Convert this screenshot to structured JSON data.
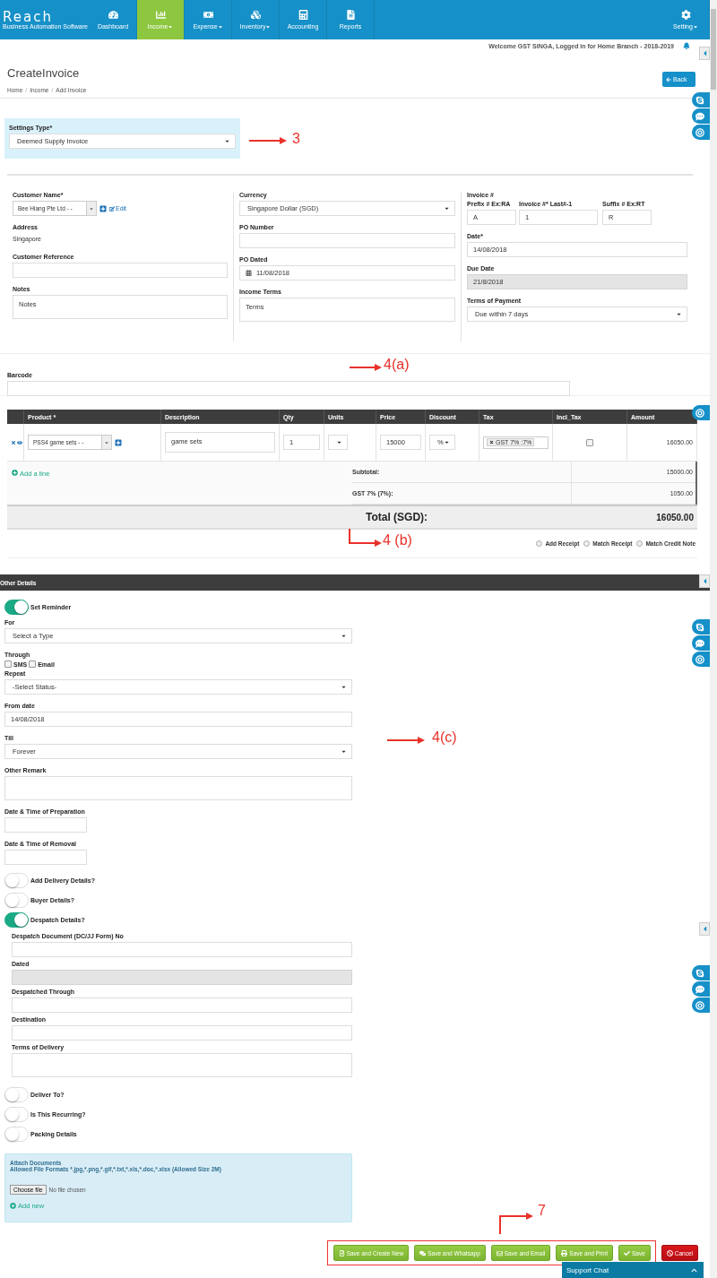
{
  "nav": {
    "logo": "Reach",
    "logo_sub": "Business Automation Software",
    "items": [
      {
        "label": "Dashboard",
        "selected": false,
        "dropdown": false
      },
      {
        "label": "Income",
        "selected": true,
        "dropdown": true
      },
      {
        "label": "Expense",
        "selected": false,
        "dropdown": true
      },
      {
        "label": "Inventory",
        "selected": false,
        "dropdown": true
      },
      {
        "label": "Accounting",
        "selected": false,
        "dropdown": false
      },
      {
        "label": "Reports",
        "selected": false,
        "dropdown": false
      }
    ],
    "setting": {
      "label": "Setting",
      "dropdown": true
    }
  },
  "welcome": "Welcome GST SINGA, Logged in for Home Branch - 2018-2019",
  "page_title": "CreateInvoice",
  "breadcrumb": [
    {
      "label": "Home",
      "separator": "/"
    },
    {
      "label": "Income",
      "separator": "/"
    },
    {
      "label": "Add Invoice"
    }
  ],
  "back_button": "Back",
  "settings_type": {
    "label": "Settings Type*",
    "value": "Deemed Supply Invoice"
  },
  "invoice_form": {
    "columns": [
      [
        {
          "kind": "combo",
          "label": "Customer Name*",
          "value": "Bee Hiang Pte Ltd - -",
          "link": "Edit"
        },
        {
          "kind": "text",
          "label": "Address",
          "value": "Singapore"
        },
        {
          "kind": "input",
          "label": "Customer Reference",
          "disabled": false
        },
        {
          "kind": "textarea",
          "label": "Notes",
          "placeholder": "Notes"
        }
      ],
      [
        {
          "kind": "select",
          "label": "Currency",
          "value": "Singapore Dollar (SGD)"
        },
        {
          "kind": "input",
          "label": "PO Number",
          "disabled": false
        },
        {
          "kind": "date",
          "label": "PO Dated",
          "value": "11/08/2018"
        },
        {
          "kind": "textarea",
          "label": "Income Terms",
          "placeholder": "Terms"
        }
      ],
      [
        {
          "kind": "triple",
          "label": "Invoice #",
          "parts": [
            {
              "label": "Prefix # Ex:RA",
              "value": "A"
            },
            {
              "label": "Invoice #* Last#-1",
              "value": "1"
            },
            {
              "label": "Suffix # Ex:RT",
              "value": "R"
            }
          ]
        },
        {
          "kind": "input",
          "label": "Date*",
          "value": "14/08/2018",
          "disabled": false
        },
        {
          "kind": "input",
          "label": "Due Date",
          "value": "21/8/2018",
          "disabled": true
        },
        {
          "kind": "select",
          "label": "Terms of Payment",
          "value": "Due within 7 days"
        }
      ]
    ]
  },
  "barcode": {
    "label": "Barcode"
  },
  "table": {
    "columns": [
      "Product *",
      "Description",
      "Qty",
      "Units",
      "Price",
      "Discount",
      "Tax",
      "Incl_Tax",
      "Amount"
    ],
    "rows": [
      {
        "product": "PSS4 game sets - -",
        "description": "game sets",
        "qty": "1",
        "price": "15000",
        "discount": "%",
        "tax": "GST 7% :7%",
        "incl_tax": false,
        "amount": "16050.00"
      }
    ],
    "add_line": "Add a line",
    "totals": [
      {
        "label": "Subtotal:",
        "value": "15000.00"
      },
      {
        "label": "GST 7% (7%):",
        "value": "1050.00"
      }
    ],
    "total": {
      "label": "Total (SGD):",
      "value": "16050.00"
    },
    "options": [
      {
        "label": "Add Receipt",
        "selected": false
      },
      {
        "label": "Match Receipt",
        "selected": false
      },
      {
        "label": "Match Credit Note",
        "selected": false
      }
    ]
  },
  "other_details": {
    "title": "Other Details",
    "items": [
      {
        "kind": "toggle",
        "label": "Set Reminder",
        "on": true
      },
      {
        "kind": "select",
        "label": "For",
        "value": "Select a Type"
      },
      {
        "kind": "checks",
        "label": "Through",
        "options": [
          {
            "label": "SMS",
            "checked": false
          },
          {
            "label": "Email",
            "checked": false
          }
        ]
      },
      {
        "kind": "select",
        "label": "Repeat",
        "value": "-Select Status-"
      },
      {
        "kind": "input",
        "label": "From date",
        "value": "14/08/2018"
      },
      {
        "kind": "select",
        "label": "Till",
        "value": "Forever"
      },
      {
        "kind": "textarea",
        "label": "Other Remark"
      },
      {
        "kind": "short_input",
        "label": "Date & Time of Preparation"
      },
      {
        "kind": "short_input",
        "label": "Date & Time of Removal"
      },
      {
        "kind": "toggle",
        "label": "Add Delivery Details?",
        "on": false
      },
      {
        "kind": "toggle",
        "label": "Buyer Details?",
        "on": false
      },
      {
        "kind": "toggle",
        "label": "Despatch Details?",
        "on": true,
        "children": [
          {
            "kind": "input",
            "label": "Despatch Document (DC/JJ Form) No",
            "disabled": false
          },
          {
            "kind": "input",
            "label": "Dated",
            "disabled": true
          },
          {
            "kind": "input",
            "label": "Despatched Through",
            "disabled": false
          },
          {
            "kind": "input",
            "label": "Destination",
            "disabled": false
          },
          {
            "kind": "textarea",
            "label": "Terms of Delivery",
            "disabled": false
          }
        ]
      },
      {
        "kind": "toggle",
        "label": "Deliver To?",
        "on": false
      },
      {
        "kind": "toggle",
        "label": "Is This Recurring?",
        "on": false
      },
      {
        "kind": "toggle",
        "label": "Packing Details",
        "on": false
      }
    ],
    "attach": {
      "title": "Attach Documents",
      "formats": "Allowed File Formats *.jpg,*.png,*.gif,*.txt,*.xls,*.doc,*.xlsx (Allowed Size 2M)",
      "choose": "Choose file",
      "status": "No file chosen",
      "add": "Add new"
    }
  },
  "buttons": [
    {
      "label": "Save and Create New",
      "kind": "success",
      "framed": true
    },
    {
      "label": "Save and Whatsapp",
      "kind": "success",
      "framed": true
    },
    {
      "label": "Save and Email",
      "kind": "success",
      "framed": true
    },
    {
      "label": "Save and Print",
      "kind": "success",
      "framed": true
    },
    {
      "label": "Save",
      "kind": "success",
      "framed": true
    },
    {
      "label": "Cancel",
      "kind": "danger",
      "framed": false
    }
  ],
  "support_chat": "Support Chat",
  "annotations": [
    {
      "text": "3",
      "kind": "straight"
    },
    {
      "text": "4(a)",
      "kind": "straight"
    },
    {
      "text": "4 (b)",
      "kind": "elbow"
    },
    {
      "text": "4(c)",
      "kind": "straight"
    },
    {
      "text": "7",
      "kind": "elbow"
    }
  ]
}
